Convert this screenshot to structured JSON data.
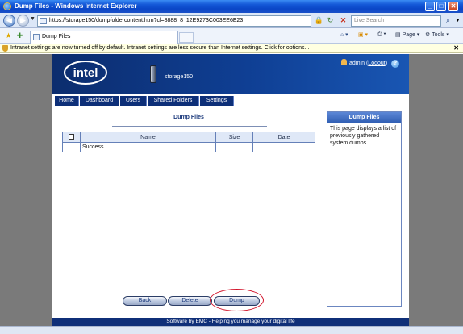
{
  "window": {
    "title": "Dump Files - Windows Internet Explorer",
    "minimize": "_",
    "maximize": "□",
    "close": "✕"
  },
  "address": {
    "url": "https://storage150/dumpfoldercontent.htm?cl=8888_8_12E9273C003EE6E23",
    "search_placeholder": "Live Search"
  },
  "tabs": {
    "active_label": "Dump Files"
  },
  "toolbar": {
    "page_label": "Page",
    "tools_label": "Tools"
  },
  "infobar": {
    "message": "Intranet settings are now turned off by default. Intranet settings are less secure than Internet settings. Click for options..."
  },
  "header": {
    "logo_text": "intel",
    "device_name": "storage150",
    "user": "admin",
    "logout_label": "Logout",
    "help_glyph": "?"
  },
  "nav": {
    "items": [
      "Home",
      "Dashboard",
      "Users",
      "Shared Folders",
      "Settings"
    ]
  },
  "main": {
    "section_title": "Dump Files",
    "columns": [
      "Name",
      "Size",
      "Date"
    ],
    "rows": [
      {
        "name": "Success",
        "size": "",
        "date": ""
      }
    ]
  },
  "side_panel": {
    "heading": "Dump Files",
    "text": "This page displays a list of previously gathered system dumps."
  },
  "actions": {
    "back_label": "Back",
    "delete_label": "Delete",
    "dump_label": "Dump"
  },
  "footer": {
    "text": "Software by EMC - Helping you manage your digital life"
  },
  "colors": {
    "brand_blue": "#0f3f94",
    "highlight_circle": "#d2142b"
  }
}
